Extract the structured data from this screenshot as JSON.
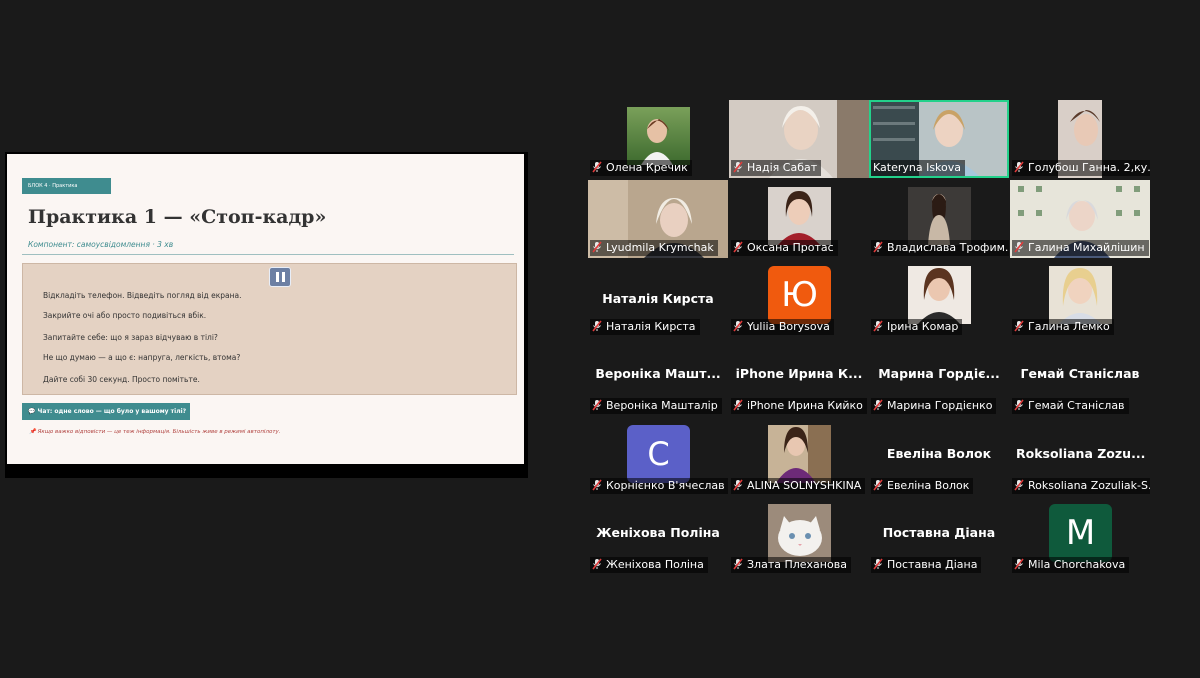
{
  "slide": {
    "block_tag": "БЛОК 4 · Практика",
    "title": "Практика 1 — «Стоп-кадр»",
    "subtitle": "Компонент: самоусвідомлення · 3 хв",
    "steps": [
      "Відкладіть телефон. Відведіть погляд від екрана.",
      "Закрийте очі або просто подивіться вбік.",
      "Запитайте себе: що я зараз відчуваю в тілі?",
      "Не що думаю — а що є: напруга, легкість, втома?",
      "Дайте собі 30 секунд. Просто помітьте."
    ],
    "chat_prompt": "💬 Чат: одне слово — що було у вашому тілі?",
    "footnote": "📌 Якщо важко відповісти — це теж інформація. Більшість живе в режимі автопілоту."
  },
  "participants": [
    {
      "name": "Олена Кречик",
      "raised_hand": true
    },
    {
      "name": "Надія Сабат"
    },
    {
      "name": "Kateryna Iskova",
      "active_speaker": true
    },
    {
      "name": "Голубош Ганна. 2,ку..."
    },
    {
      "name": "Lyudmila Krymchak"
    },
    {
      "name": "Оксана Протас"
    },
    {
      "name": "Владислава Трофим..."
    },
    {
      "name": "Галина Михайлішин"
    },
    {
      "name": "Наталія Кирста",
      "display": "Наталія Кирста"
    },
    {
      "name": "Yuliia Borysova",
      "letter": "Ю"
    },
    {
      "name": "Ірина Комар"
    },
    {
      "name": "Галина Лемко"
    },
    {
      "name": "Вероніка Машталір",
      "display": "Вероніка Машт..."
    },
    {
      "name": "iPhone Ирина Кийко",
      "display": "iPhone Ирина К..."
    },
    {
      "name": "Марина Гордієнко",
      "display": "Марина Гордіє..."
    },
    {
      "name": "Гемай Станіслав",
      "display": "Гемай Станіслав"
    },
    {
      "name": "Корнієнко В'ячеслав",
      "letter": "C"
    },
    {
      "name": "ALINA SOLNYSHKINA"
    },
    {
      "name": "Евеліна Волок",
      "display": "Евеліна Волок"
    },
    {
      "name": "Roksoliana Zozuliak-S...",
      "display": "Roksoliana Zozu..."
    },
    {
      "name": "Женіхова Поліна",
      "display": "Женіхова Поліна"
    },
    {
      "name": "Злата Плеханова"
    },
    {
      "name": "Поставна Діана",
      "display": "Поставна Діана"
    },
    {
      "name": "Mila Chorchakova",
      "letter": "M"
    }
  ],
  "colors": {
    "accent_teal": "#3f8c8f",
    "active_speaker_border": "#23d18b",
    "muted_icon": "#e03b3b"
  }
}
